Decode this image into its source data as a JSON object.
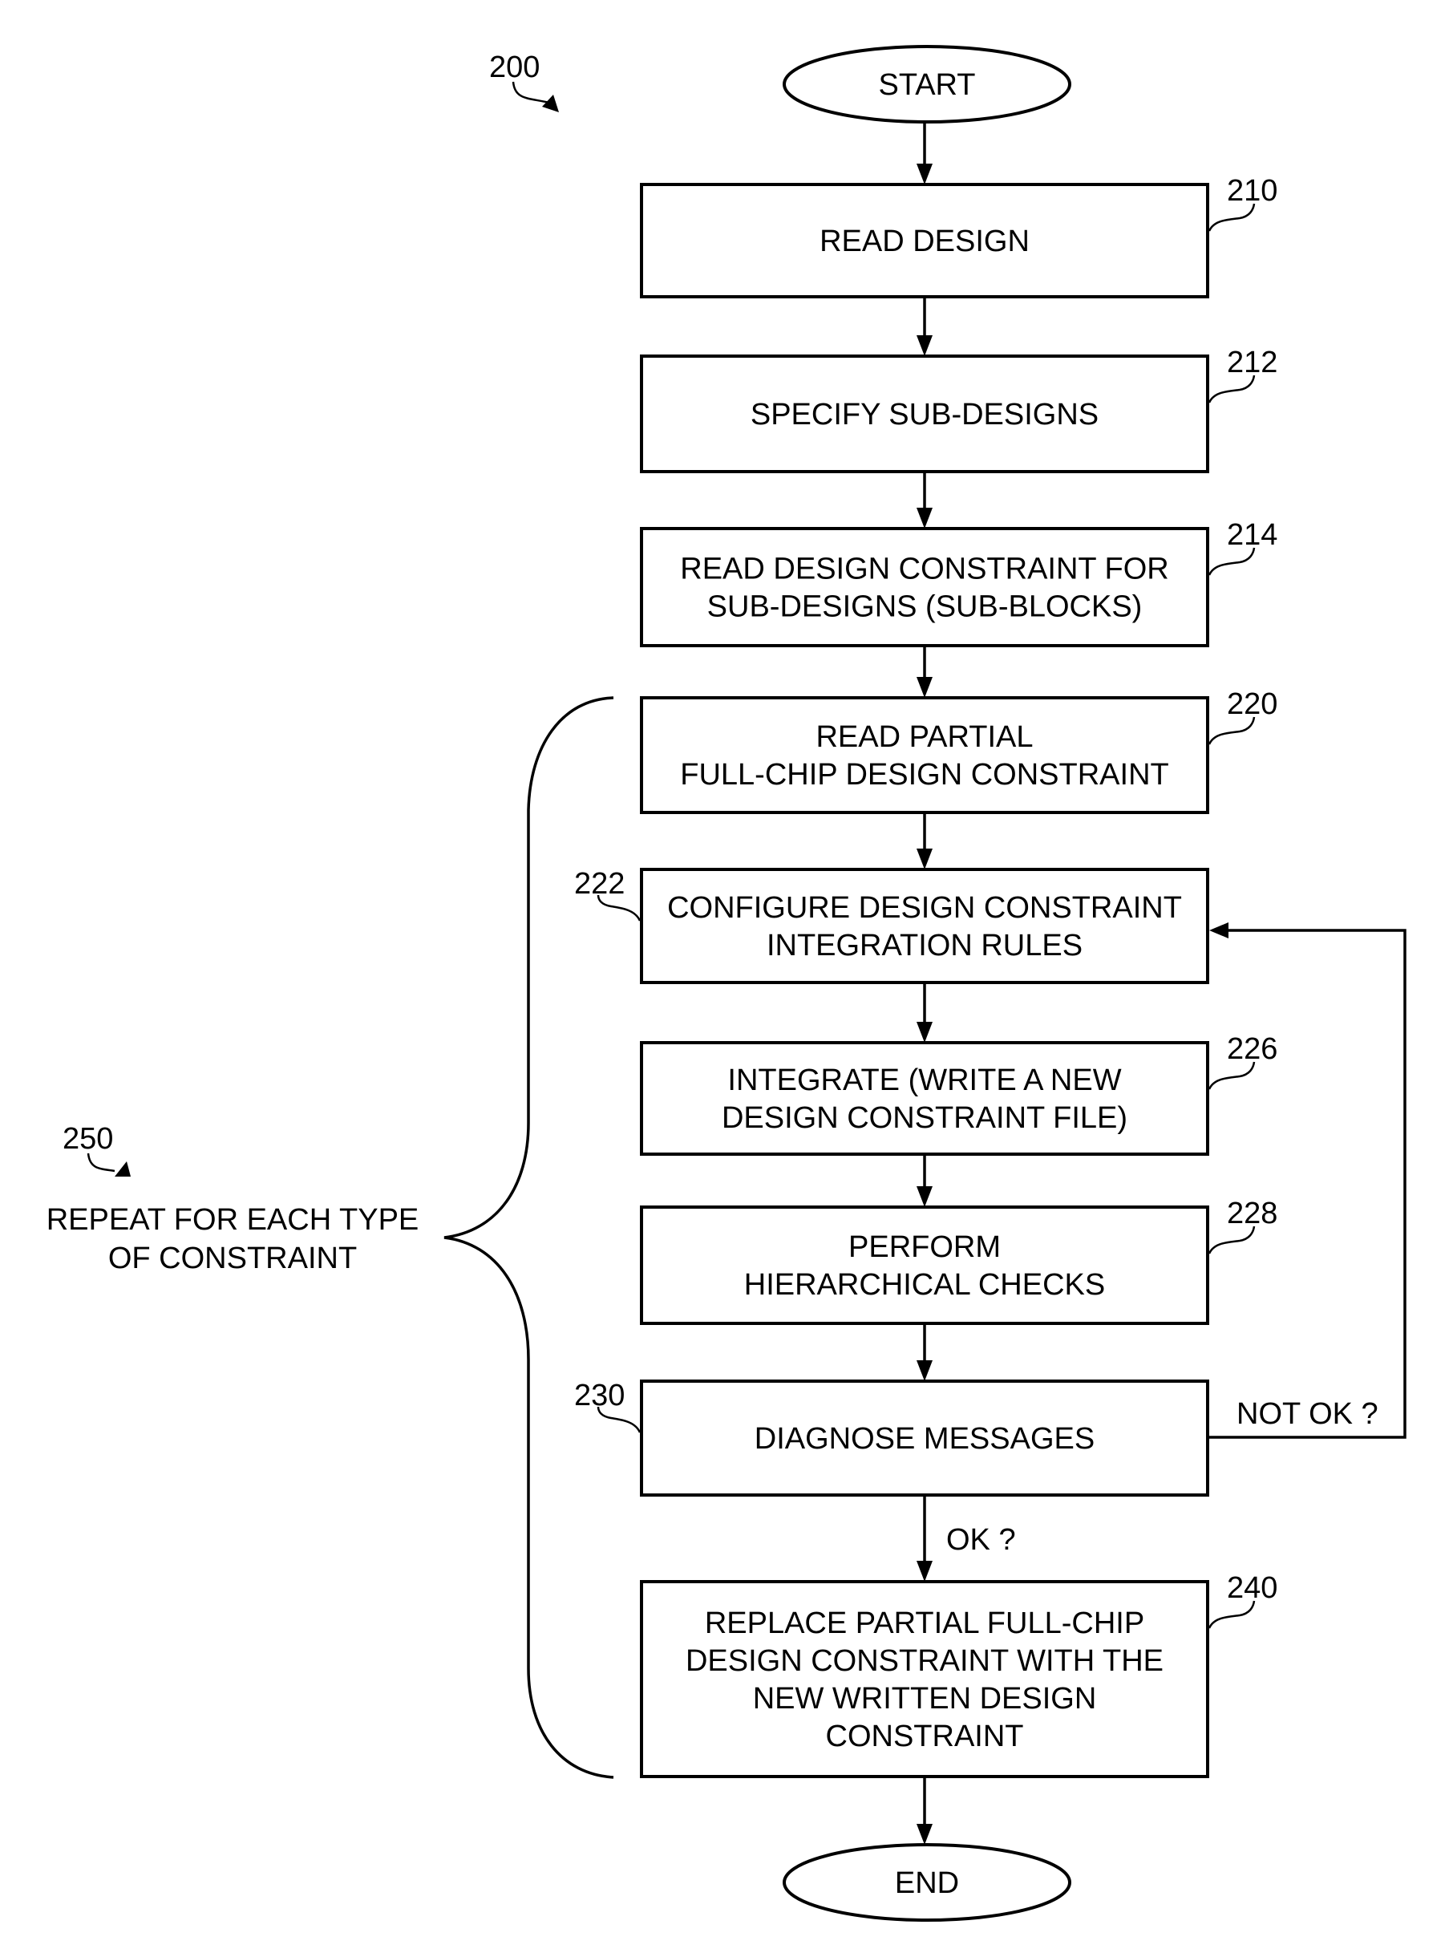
{
  "figure": {
    "ref": "200",
    "start_label": "START",
    "end_label": "END"
  },
  "steps": [
    {
      "ref": "210",
      "lines": [
        "READ DESIGN"
      ]
    },
    {
      "ref": "212",
      "lines": [
        "SPECIFY SUB-DESIGNS"
      ]
    },
    {
      "ref": "214",
      "lines": [
        "READ DESIGN CONSTRAINT FOR",
        "SUB-DESIGNS (SUB-BLOCKS)"
      ]
    },
    {
      "ref": "220",
      "lines": [
        "READ PARTIAL",
        "FULL-CHIP DESIGN CONSTRAINT"
      ]
    },
    {
      "ref": "222",
      "lines": [
        "CONFIGURE DESIGN CONSTRAINT",
        "INTEGRATION RULES"
      ]
    },
    {
      "ref": "226",
      "lines": [
        "INTEGRATE (WRITE A NEW",
        "DESIGN CONSTRAINT FILE)"
      ]
    },
    {
      "ref": "228",
      "lines": [
        "PERFORM",
        "HIERARCHICAL CHECKS"
      ]
    },
    {
      "ref": "230",
      "lines": [
        "DIAGNOSE MESSAGES"
      ]
    },
    {
      "ref": "240",
      "lines": [
        "REPLACE PARTIAL FULL-CHIP",
        "DESIGN CONSTRAINT WITH THE",
        "NEW WRITTEN DESIGN",
        "CONSTRAINT"
      ]
    }
  ],
  "branches": {
    "not_ok": "NOT OK ?",
    "ok": "OK ?"
  },
  "loop": {
    "ref": "250",
    "lines": [
      "REPEAT FOR EACH TYPE",
      "OF CONSTRAINT"
    ]
  }
}
